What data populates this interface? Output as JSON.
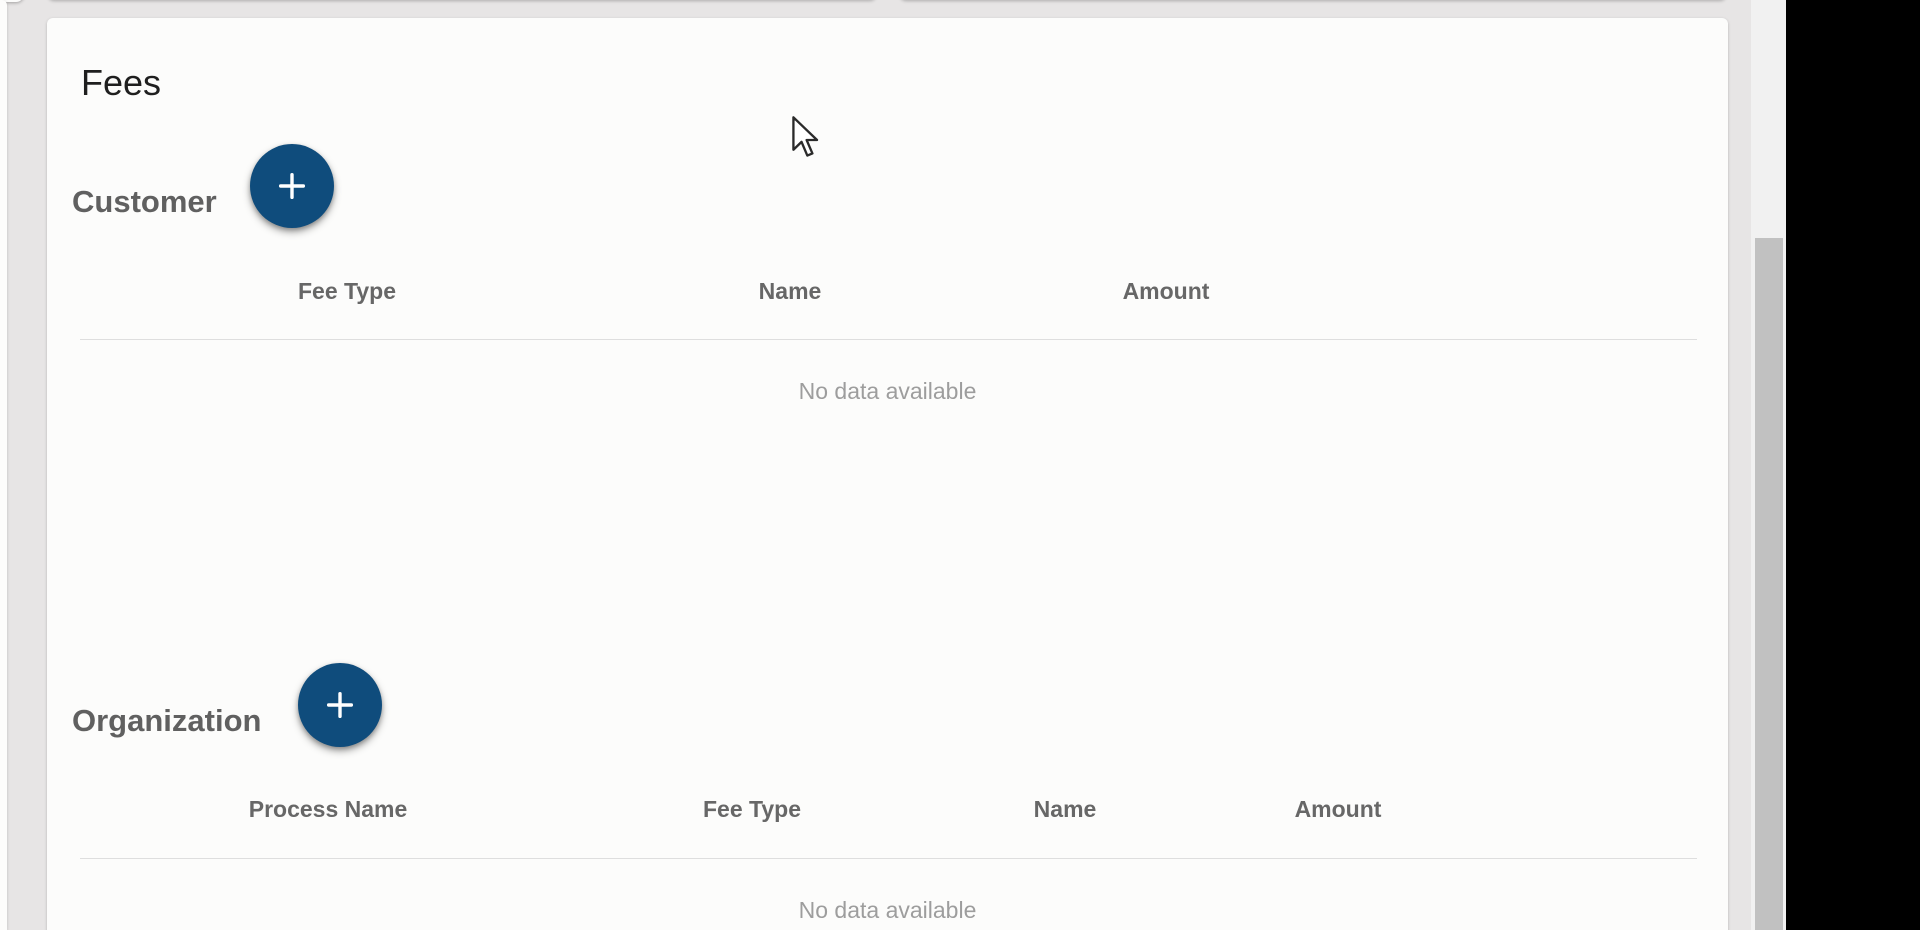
{
  "fees": {
    "title": "Fees",
    "customer": {
      "heading": "Customer",
      "add_icon": "plus-icon",
      "columns": [
        "Fee Type",
        "Name",
        "Amount"
      ],
      "empty_text": "No data available"
    },
    "organization": {
      "heading": "Organization",
      "add_icon": "plus-icon",
      "columns": [
        "Process Name",
        "Fee Type",
        "Name",
        "Amount"
      ],
      "empty_text": "No data available"
    }
  },
  "colors": {
    "fab": "#0f4c7c",
    "card": "#fcfcfb",
    "page_bg": "#e7e5e5",
    "header_text": "#676767",
    "empty_text": "#9d9d9d"
  }
}
